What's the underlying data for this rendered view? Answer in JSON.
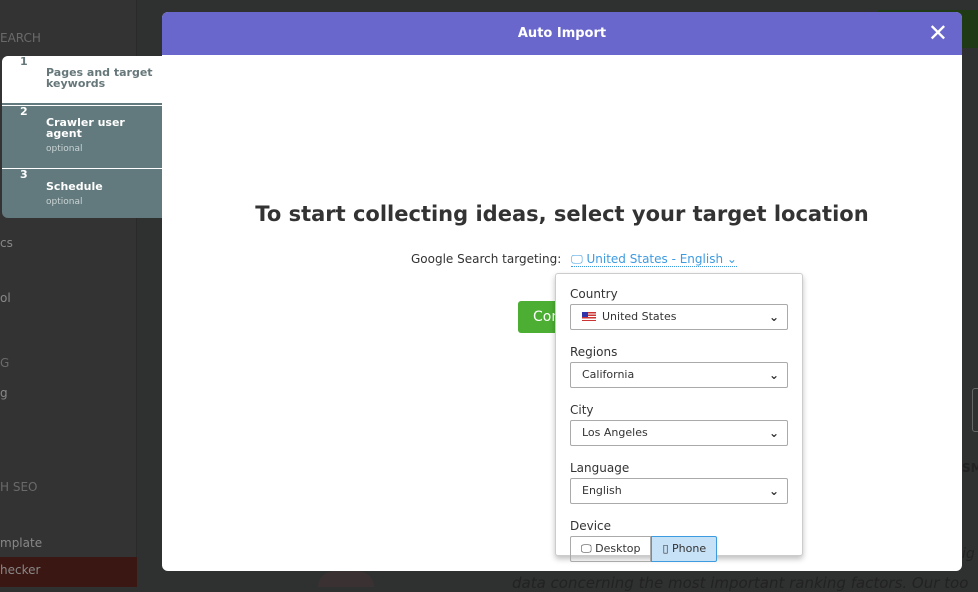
{
  "background": {
    "sidebar_fragments": [
      "EARCH",
      "cs",
      "ol",
      "G",
      "g",
      "H SEO",
      "mplate",
      "hecker"
    ],
    "right_fragment": "SM",
    "italic_fragment": "ig",
    "bottom_text": "data concerning the most important ranking factors. Our too"
  },
  "modal": {
    "title": "Auto Import",
    "close": "✕",
    "steps": [
      {
        "num": "1",
        "label": "Pages and target keywords"
      },
      {
        "num": "2",
        "label": "Crawler user agent",
        "note": "optional"
      },
      {
        "num": "3",
        "label": "Schedule",
        "note": "optional"
      }
    ],
    "heading": "To start collecting ideas, select your target location",
    "targeting_label": "Google Search targeting:",
    "targeting_value": "United States - English",
    "continue_label": "Continue",
    "dropdown": {
      "country_label": "Country",
      "country": "United States",
      "regions_label": "Regions",
      "region": "California",
      "city_label": "City",
      "city": "Los Angeles",
      "language_label": "Language",
      "language": "English",
      "device_label": "Device",
      "devices": [
        "Desktop",
        "Phone"
      ],
      "selected_device": "Phone"
    }
  },
  "colors": {
    "header": "#6a67cc",
    "accent": "#3d9be0",
    "continue": "#4caf33"
  }
}
